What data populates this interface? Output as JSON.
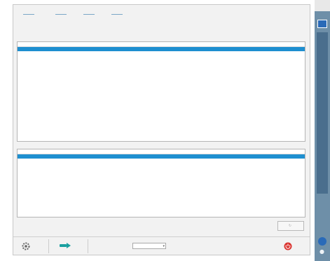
{
  "window": {
    "title": ""
  },
  "stats": [
    {
      "label": "",
      "value": "",
      "color": "#2e6da4"
    },
    {
      "label": "",
      "value": "",
      "sub": "",
      "color": "#2e8b57"
    },
    {
      "label": "",
      "value": "",
      "color": "#d9302c"
    },
    {
      "label": "",
      "value": "",
      "color": "#1aa0c8"
    }
  ],
  "table1": {
    "title": "",
    "columns": [
      "",
      "",
      "",
      "",
      "",
      "",
      "",
      ""
    ]
  },
  "table2": {
    "title": "",
    "columns": [
      "",
      "",
      "",
      "",
      "",
      "",
      "",
      ""
    ]
  },
  "footer": {
    "refresh_label": "",
    "settings_label": "",
    "next_label": "",
    "field_label": "",
    "field_value": "",
    "exit_label": ""
  },
  "sidebar": {
    "title": ""
  },
  "colors": {
    "accent": "#1e8fd0",
    "danger": "#d9302c",
    "sidebar": "#6e8fa8"
  }
}
